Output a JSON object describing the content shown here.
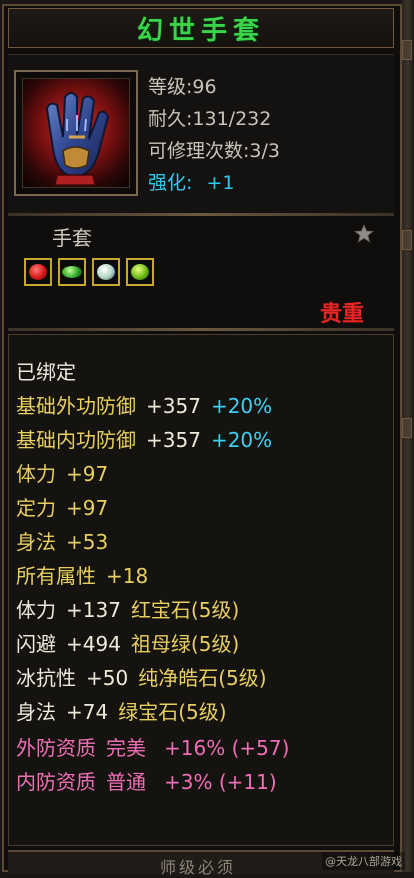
{
  "item": {
    "name": "幻世手套",
    "level": "等级:96",
    "durability": "耐久:131/232",
    "repair": "可修理次数:3/3",
    "enhance_label": "强化:",
    "enhance_value": "+1",
    "type": "手套",
    "rarity": "贵重",
    "icon": "glove-icon"
  },
  "gems_icons": [
    "ruby-gem-icon",
    "emerald-gem-icon",
    "diamond-gem-icon",
    "green-gem-icon"
  ],
  "properties": [
    {
      "key": "已绑定",
      "value": "",
      "extra": "",
      "color": "white"
    },
    {
      "key": "基础外功防御",
      "value": "+357",
      "extra": "+20%",
      "color": "yellow"
    },
    {
      "key": "基础内功防御",
      "value": "+357",
      "extra": "+20%",
      "color": "yellow"
    },
    {
      "key": "体力",
      "value": "+97",
      "extra": "",
      "color": "yellow"
    },
    {
      "key": "定力",
      "value": "+97",
      "extra": "",
      "color": "yellow"
    },
    {
      "key": "身法",
      "value": "+53",
      "extra": "",
      "color": "yellow"
    },
    {
      "key": "所有属性",
      "value": "+18",
      "extra": "",
      "color": "yellow"
    },
    {
      "key": "体力",
      "value": "+137",
      "extra": "红宝石(5级)",
      "color": "white"
    },
    {
      "key": "闪避",
      "value": "+494",
      "extra": "祖母绿(5级)",
      "color": "white"
    },
    {
      "key": "冰抗性",
      "value": "+50",
      "extra": "纯净皓石(5级)",
      "color": "white"
    },
    {
      "key": "身法",
      "value": "+74",
      "extra": "绿宝石(5级)",
      "color": "white"
    },
    {
      "key": "外防资质",
      "value": "完美",
      "extra": "+16% (+57)",
      "color": "pink"
    },
    {
      "key": "内防资质",
      "value": "普通",
      "extra": "+3% (+11)",
      "color": "pink"
    }
  ],
  "footer": {
    "text": "师级必须",
    "watermark": "@天龙八部游戏"
  },
  "colors": {
    "title": "#3bd34a",
    "enhance": "#32c8ee",
    "precious": "#e82424",
    "yellow": "#e8cf62",
    "cyan": "#3ed0f2",
    "pink": "#f06eb6"
  }
}
